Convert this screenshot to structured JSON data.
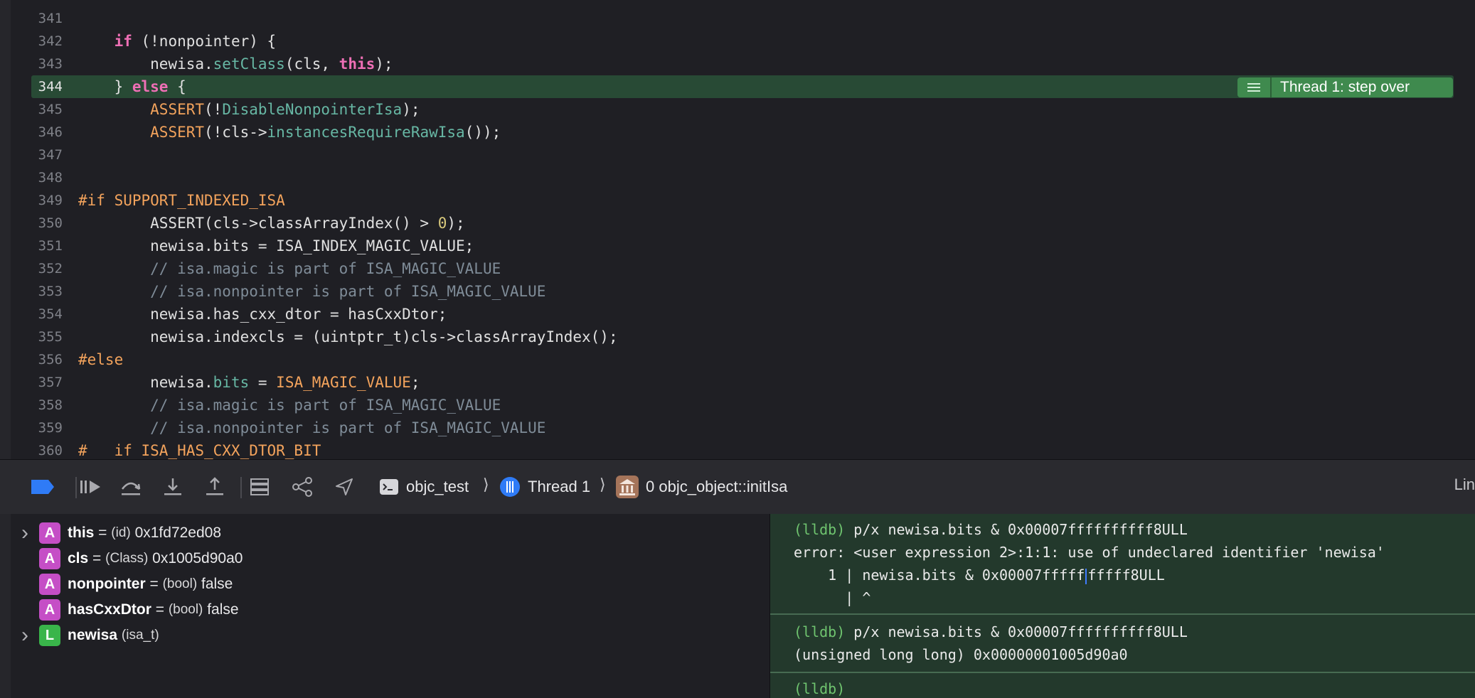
{
  "editor": {
    "current_line": "344",
    "lines": [
      {
        "n": "341",
        "parts": []
      },
      {
        "n": "342",
        "parts": [
          [
            "",
            "    "
          ],
          [
            "kw",
            "if"
          ],
          [
            "",
            " (!nonpointer) {"
          ]
        ]
      },
      {
        "n": "343",
        "parts": [
          [
            "",
            "        newisa."
          ],
          [
            "fn",
            "setClass"
          ],
          [
            "",
            "(cls, "
          ],
          [
            "kw",
            "this"
          ],
          [
            "",
            ");"
          ]
        ]
      },
      {
        "n": "344",
        "parts": [
          [
            "",
            "    } "
          ],
          [
            "kw",
            "else"
          ],
          [
            "",
            " {"
          ]
        ]
      },
      {
        "n": "345",
        "parts": [
          [
            "",
            "        "
          ],
          [
            "mac",
            "ASSERT"
          ],
          [
            "",
            "(!"
          ],
          [
            "fn",
            "DisableNonpointerIsa"
          ],
          [
            "",
            ");"
          ]
        ]
      },
      {
        "n": "346",
        "parts": [
          [
            "",
            "        "
          ],
          [
            "mac",
            "ASSERT"
          ],
          [
            "",
            "(!cls->"
          ],
          [
            "fn",
            "instancesRequireRawIsa"
          ],
          [
            "",
            "());"
          ]
        ]
      },
      {
        "n": "347",
        "parts": []
      },
      {
        "n": "348",
        "parts": []
      },
      {
        "n": "349",
        "parts": [
          [
            "pp",
            "#if SUPPORT_INDEXED_ISA"
          ]
        ]
      },
      {
        "n": "350",
        "parts": [
          [
            "",
            "        ASSERT(cls->classArrayIndex() > "
          ],
          [
            "num",
            "0"
          ],
          [
            "",
            ");"
          ]
        ]
      },
      {
        "n": "351",
        "parts": [
          [
            "",
            "        newisa.bits = ISA_INDEX_MAGIC_VALUE;"
          ]
        ]
      },
      {
        "n": "352",
        "parts": [
          [
            "cmt",
            "        // isa.magic is part of ISA_MAGIC_VALUE"
          ]
        ]
      },
      {
        "n": "353",
        "parts": [
          [
            "cmt",
            "        // isa.nonpointer is part of ISA_MAGIC_VALUE"
          ]
        ]
      },
      {
        "n": "354",
        "parts": [
          [
            "",
            "        newisa.has_cxx_dtor = hasCxxDtor;"
          ]
        ]
      },
      {
        "n": "355",
        "parts": [
          [
            "",
            "        newisa.indexcls = (uintptr_t)cls->classArrayIndex();"
          ]
        ]
      },
      {
        "n": "356",
        "parts": [
          [
            "pp",
            "#else"
          ]
        ]
      },
      {
        "n": "357",
        "parts": [
          [
            "",
            "        newisa."
          ],
          [
            "fn",
            "bits"
          ],
          [
            "",
            " = "
          ],
          [
            "mac",
            "ISA_MAGIC_VALUE"
          ],
          [
            "",
            ";"
          ]
        ]
      },
      {
        "n": "358",
        "parts": [
          [
            "cmt",
            "        // isa.magic is part of ISA_MAGIC_VALUE"
          ]
        ]
      },
      {
        "n": "359",
        "parts": [
          [
            "cmt",
            "        // isa.nonpointer is part of ISA_MAGIC_VALUE"
          ]
        ]
      },
      {
        "n": "360",
        "parts": [
          [
            "pp",
            "#   if ISA_HAS_CXX_DTOR_BIT"
          ]
        ]
      }
    ],
    "thread_badge": "Thread 1: step over"
  },
  "debugbar": {
    "scheme": "objc_test",
    "thread": "Thread 1",
    "frame": "0 objc_object::initIsa",
    "trailing": "Lin"
  },
  "variables": [
    {
      "expand": true,
      "badge": "A",
      "name": "this",
      "eq": " = ",
      "type": "(id)",
      "value": " 0x1fd72ed08"
    },
    {
      "expand": false,
      "badge": "A",
      "name": "cls",
      "eq": " = ",
      "type": "(Class)",
      "value": " 0x1005d90a0"
    },
    {
      "expand": false,
      "badge": "A",
      "name": "nonpointer",
      "eq": " = ",
      "type": "(bool)",
      "value": " false"
    },
    {
      "expand": false,
      "badge": "A",
      "name": "hasCxxDtor",
      "eq": " = ",
      "type": "(bool)",
      "value": " false"
    },
    {
      "expand": true,
      "badge": "L",
      "name": "newisa",
      "eq": " ",
      "type": "(isa_t)",
      "value": ""
    }
  ],
  "console": {
    "block1": {
      "prompt": "(lldb)",
      "cmd": " p/x newisa.bits & 0x00007ffffffffff8ULL",
      "error": "error: <user expression 2>:1:1: use of undeclared identifier 'newisa'",
      "echo_a": "    1 | newisa.bits & 0x00007fffff",
      "echo_b": "fffff8ULL",
      "marker": "      | ^"
    },
    "block2": {
      "prompt": "(lldb)",
      "cmd": " p/x newisa.bits & 0x00007ffffffffff8ULL",
      "result": "(unsigned long long) 0x00000001005d90a0"
    },
    "block3": {
      "prompt": "(lldb)"
    }
  }
}
